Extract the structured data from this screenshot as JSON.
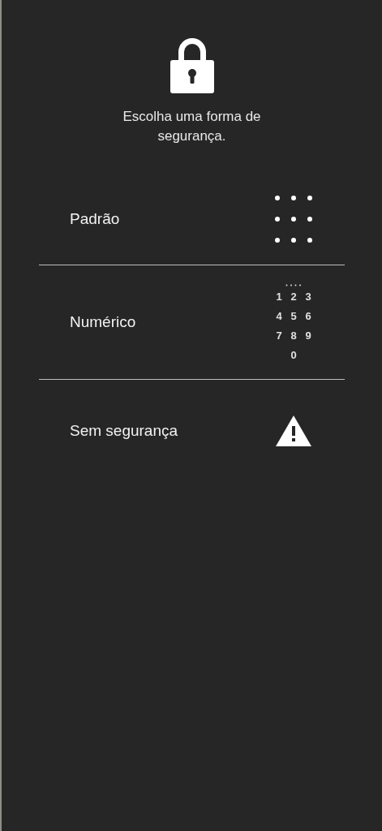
{
  "header": {
    "message": "Escolha uma forma de segurança."
  },
  "options": [
    {
      "kind": "pattern",
      "label": "Padrão"
    },
    {
      "kind": "numeric",
      "label": "Numérico",
      "keys": [
        "1",
        "2",
        "3",
        "4",
        "5",
        "6",
        "7",
        "8",
        "9",
        "0"
      ]
    },
    {
      "kind": "none",
      "label": "Sem segurança"
    }
  ]
}
